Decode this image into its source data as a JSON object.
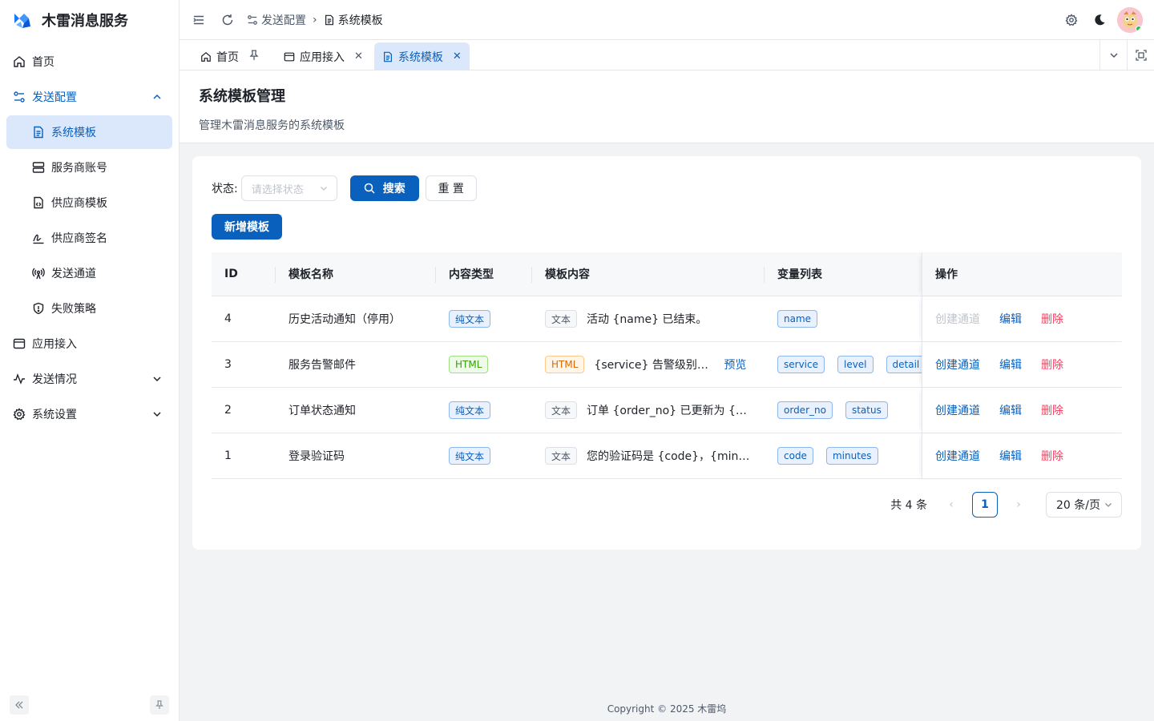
{
  "app": {
    "title": "木雷消息服务"
  },
  "sidebar": {
    "items": [
      {
        "label": "首页",
        "icon": "home-icon"
      },
      {
        "label": "发送配置",
        "icon": "config-icon"
      },
      {
        "label": "应用接入",
        "icon": "app-window-icon"
      },
      {
        "label": "发送情况",
        "icon": "activity-icon"
      },
      {
        "label": "系统设置",
        "icon": "gear-icon"
      }
    ],
    "sub_items": [
      {
        "label": "系统模板",
        "icon": "file-text-icon"
      },
      {
        "label": "服务商账号",
        "icon": "server-icon"
      },
      {
        "label": "供应商模板",
        "icon": "file-code-icon"
      },
      {
        "label": "供应商签名",
        "icon": "signature-icon"
      },
      {
        "label": "发送通道",
        "icon": "radio-tower-icon"
      },
      {
        "label": "失败策略",
        "icon": "shield-icon"
      }
    ]
  },
  "header": {
    "breadcrumb": [
      "发送配置",
      "系统模板"
    ]
  },
  "tabs": [
    {
      "label": "首页"
    },
    {
      "label": "应用接入"
    },
    {
      "label": "系统模板"
    }
  ],
  "page": {
    "title": "系统模板管理",
    "description": "管理木雷消息服务的系统模板"
  },
  "filter": {
    "status_label": "状态:",
    "status_placeholder": "请选择状态",
    "search_label": "搜索",
    "reset_label": "重 置",
    "add_label": "新增模板"
  },
  "table": {
    "columns": [
      "ID",
      "模板名称",
      "内容类型",
      "模板内容",
      "变量列表",
      "操作"
    ],
    "rows": [
      {
        "id": "4",
        "name": "历史活动通知（停用）",
        "type": "纯文本",
        "content_tag": "文本",
        "content": "活动 {name} 已结束。",
        "preview": "",
        "vars": [
          "name"
        ],
        "op_create": "创建通道",
        "op_edit": "编辑",
        "op_delete": "删除"
      },
      {
        "id": "3",
        "name": "服务告警邮件",
        "type": "HTML",
        "content_tag": "HTML",
        "content": "{service} 告警级别：{l...",
        "preview": "预览",
        "vars": [
          "service",
          "level",
          "detail"
        ],
        "op_create": "创建通道",
        "op_edit": "编辑",
        "op_delete": "删除"
      },
      {
        "id": "2",
        "name": "订单状态通知",
        "type": "纯文本",
        "content_tag": "文本",
        "content": "订单 {order_no} 已更新为 {stat...",
        "preview": "",
        "vars": [
          "order_no",
          "status"
        ],
        "op_create": "创建通道",
        "op_edit": "编辑",
        "op_delete": "删除"
      },
      {
        "id": "1",
        "name": "登录验证码",
        "type": "纯文本",
        "content_tag": "文本",
        "content": "您的验证码是 {code}，{minute...",
        "preview": "",
        "vars": [
          "code",
          "minutes"
        ],
        "op_create": "创建通道",
        "op_edit": "编辑",
        "op_delete": "删除"
      }
    ]
  },
  "pagination": {
    "total": "共 4 条",
    "current": "1",
    "page_size": "20 条/页"
  },
  "footer": {
    "copyright": "Copyright © 2025 木雷坞"
  },
  "colors": {
    "accent": "#0960bd",
    "danger": "#f53f5f",
    "active_bg": "#dbe8fb"
  }
}
